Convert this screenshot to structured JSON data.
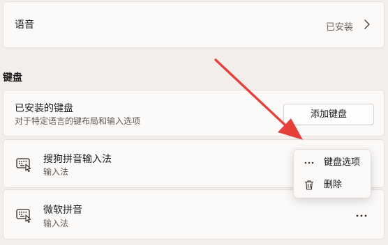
{
  "speech": {
    "title": "语音",
    "status": "已安装"
  },
  "keyboard": {
    "heading": "键盘",
    "installed": {
      "title": "已安装的键盘",
      "description": "对于特定语言的键布局和输入选项",
      "add_button": "添加键盘"
    },
    "items": [
      {
        "name": "搜狗拼音输入法",
        "type": "输入法"
      },
      {
        "name": "微软拼音",
        "type": "输入法"
      }
    ]
  },
  "context_menu": {
    "items": [
      {
        "label": "键盘选项",
        "icon": "more-horizontal-icon"
      },
      {
        "label": "删除",
        "icon": "trash-icon"
      }
    ]
  },
  "colors": {
    "arrow": "#e5403a",
    "background": "#f3eeeb",
    "card": "#fcfaf9"
  }
}
